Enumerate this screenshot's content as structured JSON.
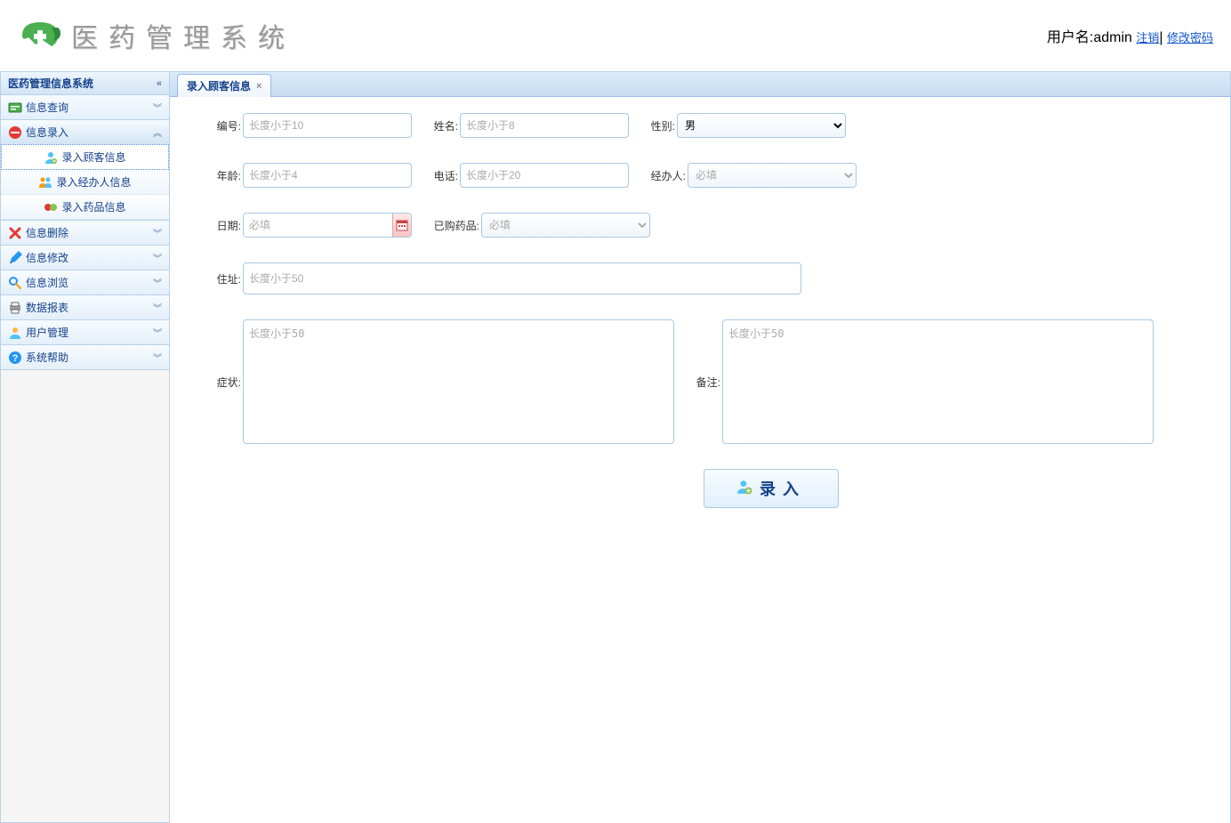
{
  "header": {
    "title": "医药管理系统",
    "user_prefix": "用户名:",
    "username": "admin",
    "logout": "注销",
    "separator": "|",
    "change_pwd": "修改密码"
  },
  "sidebar": {
    "title": "医药管理信息系统",
    "items": [
      {
        "label": "信息查询",
        "open": false
      },
      {
        "label": "信息录入",
        "open": true,
        "children": [
          {
            "label": "录入顾客信息",
            "active": true
          },
          {
            "label": "录入经办人信息"
          },
          {
            "label": "录入药品信息"
          }
        ]
      },
      {
        "label": "信息删除",
        "open": false
      },
      {
        "label": "信息修改",
        "open": false
      },
      {
        "label": "信息浏览",
        "open": false
      },
      {
        "label": "数据报表",
        "open": false
      },
      {
        "label": "用户管理",
        "open": false
      },
      {
        "label": "系统帮助",
        "open": false
      }
    ]
  },
  "tabs": [
    {
      "label": "录入顾客信息"
    }
  ],
  "form": {
    "id": {
      "label": "编号:",
      "placeholder": "长度小于10"
    },
    "name": {
      "label": "姓名:",
      "placeholder": "长度小于8"
    },
    "gender": {
      "label": "性别:",
      "value": "男"
    },
    "age": {
      "label": "年龄:",
      "placeholder": "长度小于4"
    },
    "phone": {
      "label": "电话:",
      "placeholder": "长度小于20"
    },
    "agent": {
      "label": "经办人:",
      "placeholder": "必填"
    },
    "date": {
      "label": "日期:",
      "placeholder": "必填"
    },
    "purchased": {
      "label": "已购药品:",
      "placeholder": "必填"
    },
    "address": {
      "label": "住址:",
      "placeholder": "长度小于50"
    },
    "symptom": {
      "label": "症状:",
      "placeholder": "长度小于50"
    },
    "remark": {
      "label": "备注:",
      "placeholder": "长度小于50"
    },
    "submit": "录入"
  }
}
